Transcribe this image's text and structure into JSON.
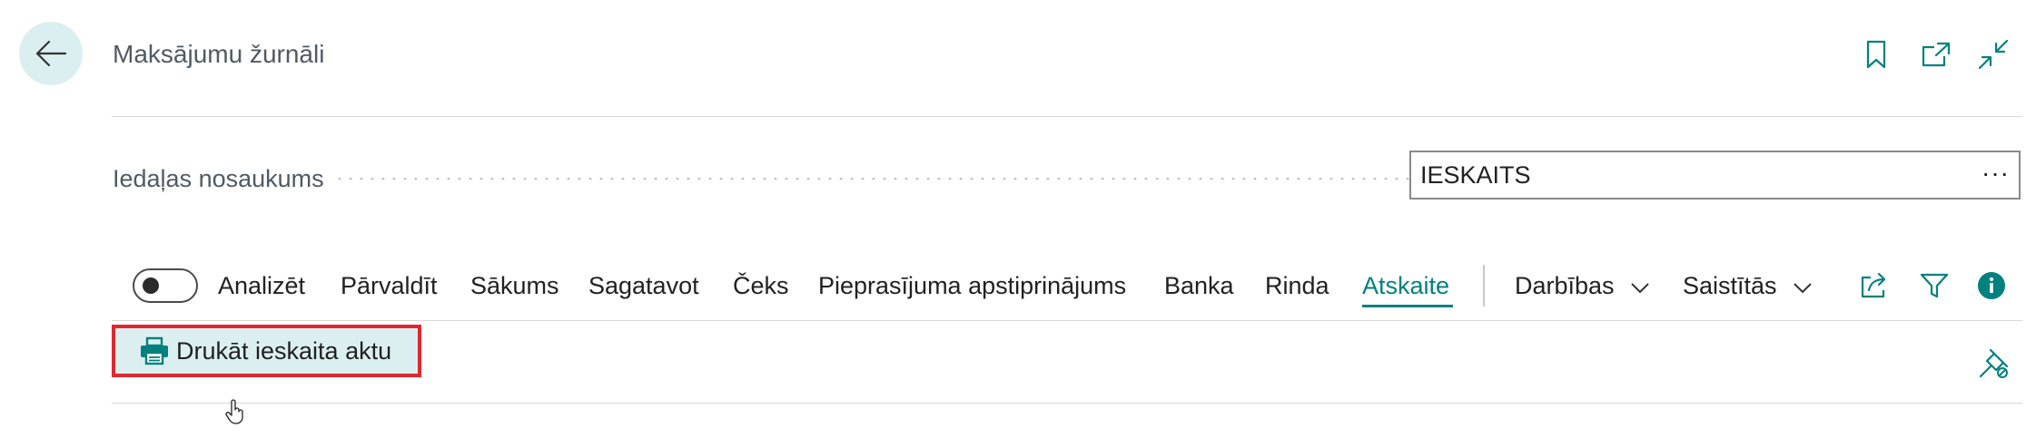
{
  "header": {
    "title": "Maksājumu žurnāli",
    "icons": [
      "back-arrow-icon",
      "bookmark-icon",
      "open-new-window-icon",
      "collapse-icon"
    ]
  },
  "field": {
    "label": "Iedaļas nosaukums",
    "value": "IESKAITS",
    "more": "···"
  },
  "menu": {
    "toggle_label": "Analizēt",
    "items": [
      "Pārvaldīt",
      "Sākums",
      "Sagatavot",
      "Čeks",
      "Pieprasījuma apstiprinājums",
      "Banka",
      "Rinda",
      "Atskaite"
    ],
    "active": "Atskaite",
    "dropdowns": [
      "Darbības",
      "Saistītās"
    ],
    "right_icons": [
      "share-icon",
      "filter-icon",
      "info-icon"
    ]
  },
  "action": {
    "label": "Drukāt ieskaita aktu",
    "icon": "printer-icon",
    "pin_icon": "unpin-icon"
  },
  "colors": {
    "accent": "#00817f",
    "highlight_border": "#e0282e",
    "action_bg": "#dceff0"
  }
}
